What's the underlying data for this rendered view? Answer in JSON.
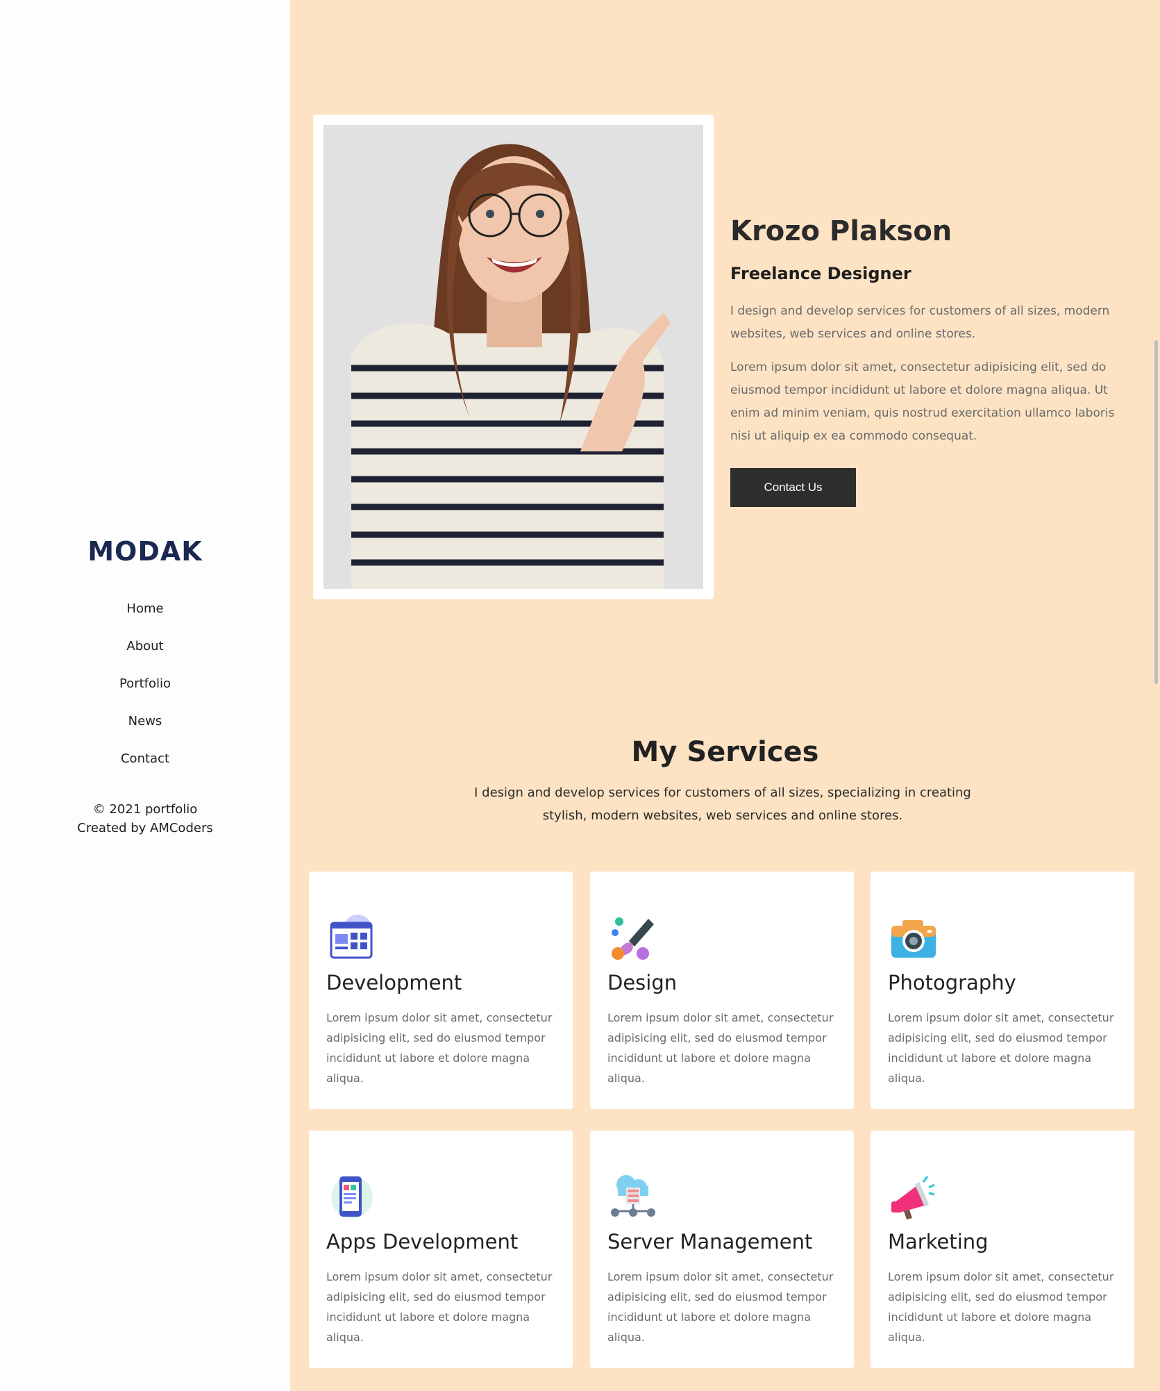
{
  "sidebar": {
    "logo_text": "MODAK",
    "nav": [
      "Home",
      "About",
      "Portfolio",
      "News",
      "Contact"
    ],
    "copyright": "© 2021 portfolio",
    "credit": "Created by AMCoders"
  },
  "hero": {
    "name": "Krozo Plakson",
    "role": "Freelance Designer",
    "intro": "I design and develop services for customers of all sizes, modern websites, web services and online stores.",
    "body": "Lorem ipsum dolor sit amet, consectetur adipisicing elit, sed do eiusmod tempor incididunt ut labore et dolore magna aliqua. Ut enim ad minim veniam, quis nostrud exercitation ullamco laboris nisi ut aliquip ex ea commodo consequat.",
    "button_label": "Contact Us"
  },
  "services": {
    "title": "My Services",
    "description": "I design and develop services for customers of all sizes, specializing in creating stylish, modern websites, web services and online stores.",
    "items": [
      {
        "title": "Development",
        "icon": "browser-window-icon",
        "text": "Lorem ipsum dolor sit amet, consectetur adipisicing elit, sed do eiusmod tempor incididunt ut labore et dolore magna aliqua."
      },
      {
        "title": "Design",
        "icon": "paint-brush-icon",
        "text": "Lorem ipsum dolor sit amet, consectetur adipisicing elit, sed do eiusmod tempor incididunt ut labore et dolore magna aliqua."
      },
      {
        "title": "Photography",
        "icon": "camera-icon",
        "text": "Lorem ipsum dolor sit amet, consectetur adipisicing elit, sed do eiusmod tempor incididunt ut labore et dolore magna aliqua."
      },
      {
        "title": "Apps Development",
        "icon": "mobile-app-icon",
        "text": "Lorem ipsum dolor sit amet, consectetur adipisicing elit, sed do eiusmod tempor incididunt ut labore et dolore magna aliqua."
      },
      {
        "title": "Server Management",
        "icon": "cloud-server-icon",
        "text": "Lorem ipsum dolor sit amet, consectetur adipisicing elit, sed do eiusmod tempor incididunt ut labore et dolore magna aliqua."
      },
      {
        "title": "Marketing",
        "icon": "megaphone-icon",
        "text": "Lorem ipsum dolor sit amet, consectetur adipisicing elit, sed do eiusmod tempor incididunt ut labore et dolore magna aliqua."
      }
    ]
  },
  "colors": {
    "page_background": "#fde3c4",
    "sidebar_background": "#fdfdfd",
    "button_background": "#2e2e2e",
    "logo_color": "#1a2952"
  }
}
